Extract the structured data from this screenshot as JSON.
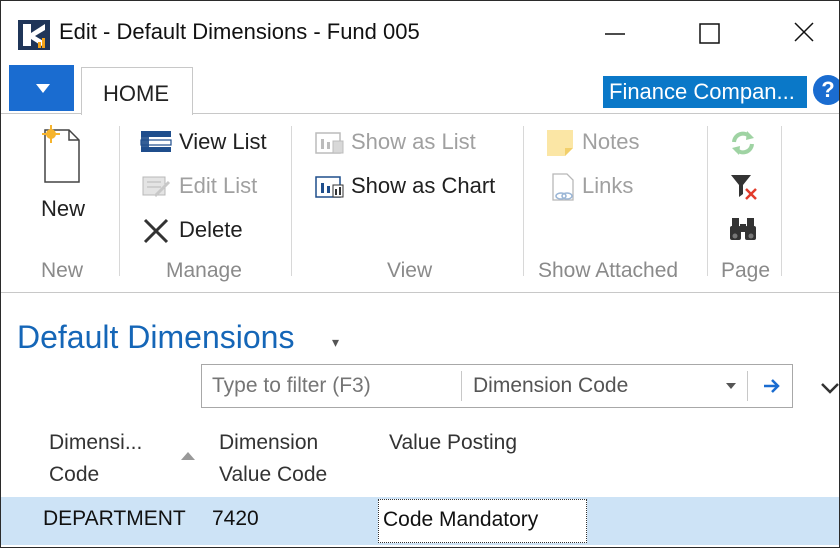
{
  "window": {
    "title": "Edit - Default Dimensions - Fund 005",
    "minimize_icon": "minimize-icon",
    "maximize_icon": "maximize-icon",
    "close_icon": "close-icon"
  },
  "ribbon_tabs": {
    "active_tab": "HOME",
    "company": "Finance Compan...",
    "help_icon": "question-icon"
  },
  "ribbon": {
    "groups": [
      {
        "label": "New",
        "items": [
          {
            "label": "New",
            "icon": "new-document-icon",
            "enabled": true
          }
        ]
      },
      {
        "label": "Manage",
        "items": [
          {
            "label": "View List",
            "icon": "view-list-icon",
            "enabled": true
          },
          {
            "label": "Edit List",
            "icon": "edit-list-icon",
            "enabled": false
          },
          {
            "label": "Delete",
            "icon": "delete-x-icon",
            "enabled": true
          }
        ]
      },
      {
        "label": "View",
        "items": [
          {
            "label": "Show as List",
            "icon": "show-as-list-icon",
            "enabled": false
          },
          {
            "label": "Show as Chart",
            "icon": "show-as-chart-icon",
            "enabled": true
          }
        ]
      },
      {
        "label": "Show Attached",
        "items": [
          {
            "label": "Notes",
            "icon": "notes-icon",
            "enabled": false
          },
          {
            "label": "Links",
            "icon": "links-icon",
            "enabled": false
          }
        ]
      },
      {
        "label": "Page",
        "items": [
          {
            "label": "",
            "icon": "refresh-icon",
            "enabled": false
          },
          {
            "label": "",
            "icon": "clear-filter-icon",
            "enabled": true
          },
          {
            "label": "",
            "icon": "find-binoculars-icon",
            "enabled": true
          }
        ]
      }
    ]
  },
  "page": {
    "title": "Default Dimensions",
    "caret": "▾"
  },
  "filter": {
    "placeholder": "Type to filter (F3)",
    "value": "",
    "field": "Dimension Code"
  },
  "table": {
    "headers": [
      [
        "Dimensi...",
        "Code"
      ],
      [
        "Dimension",
        "Value Code"
      ],
      [
        "Value Posting"
      ]
    ],
    "rows": [
      [
        "DEPARTMENT",
        "7420",
        "Code Mandatory"
      ]
    ]
  },
  "colors": {
    "accent_blue": "#1a6cd0",
    "company_blue": "#0a78c8",
    "title_blue": "#1566b7",
    "selected_row": "#cde3f6"
  }
}
